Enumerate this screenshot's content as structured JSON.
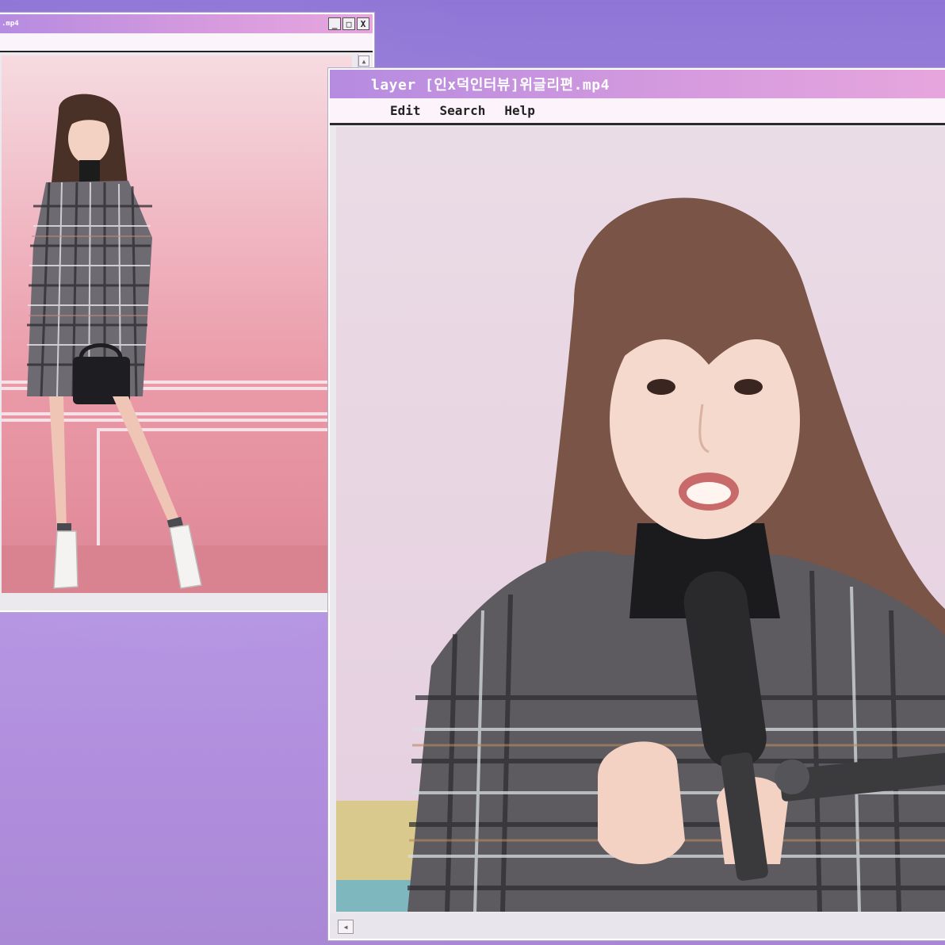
{
  "desktop": {
    "background_start": "#8f76d6",
    "background_end": "#b99be6"
  },
  "left_window": {
    "title": ".mp4",
    "controls": {
      "minimize": "_",
      "maximize": "□",
      "close": "X"
    },
    "content": "video-frame"
  },
  "right_window": {
    "title": "layer [인x덕인터뷰]위글리편.mp4",
    "menu": [
      "Edit",
      "Search",
      "Help"
    ],
    "content": "video-frame"
  },
  "colors": {
    "title_gradient_start": "#b58be0",
    "title_gradient_end": "#e7a6dd",
    "menubar": "#fdf3fb",
    "window_chrome": "#ece9ee"
  }
}
